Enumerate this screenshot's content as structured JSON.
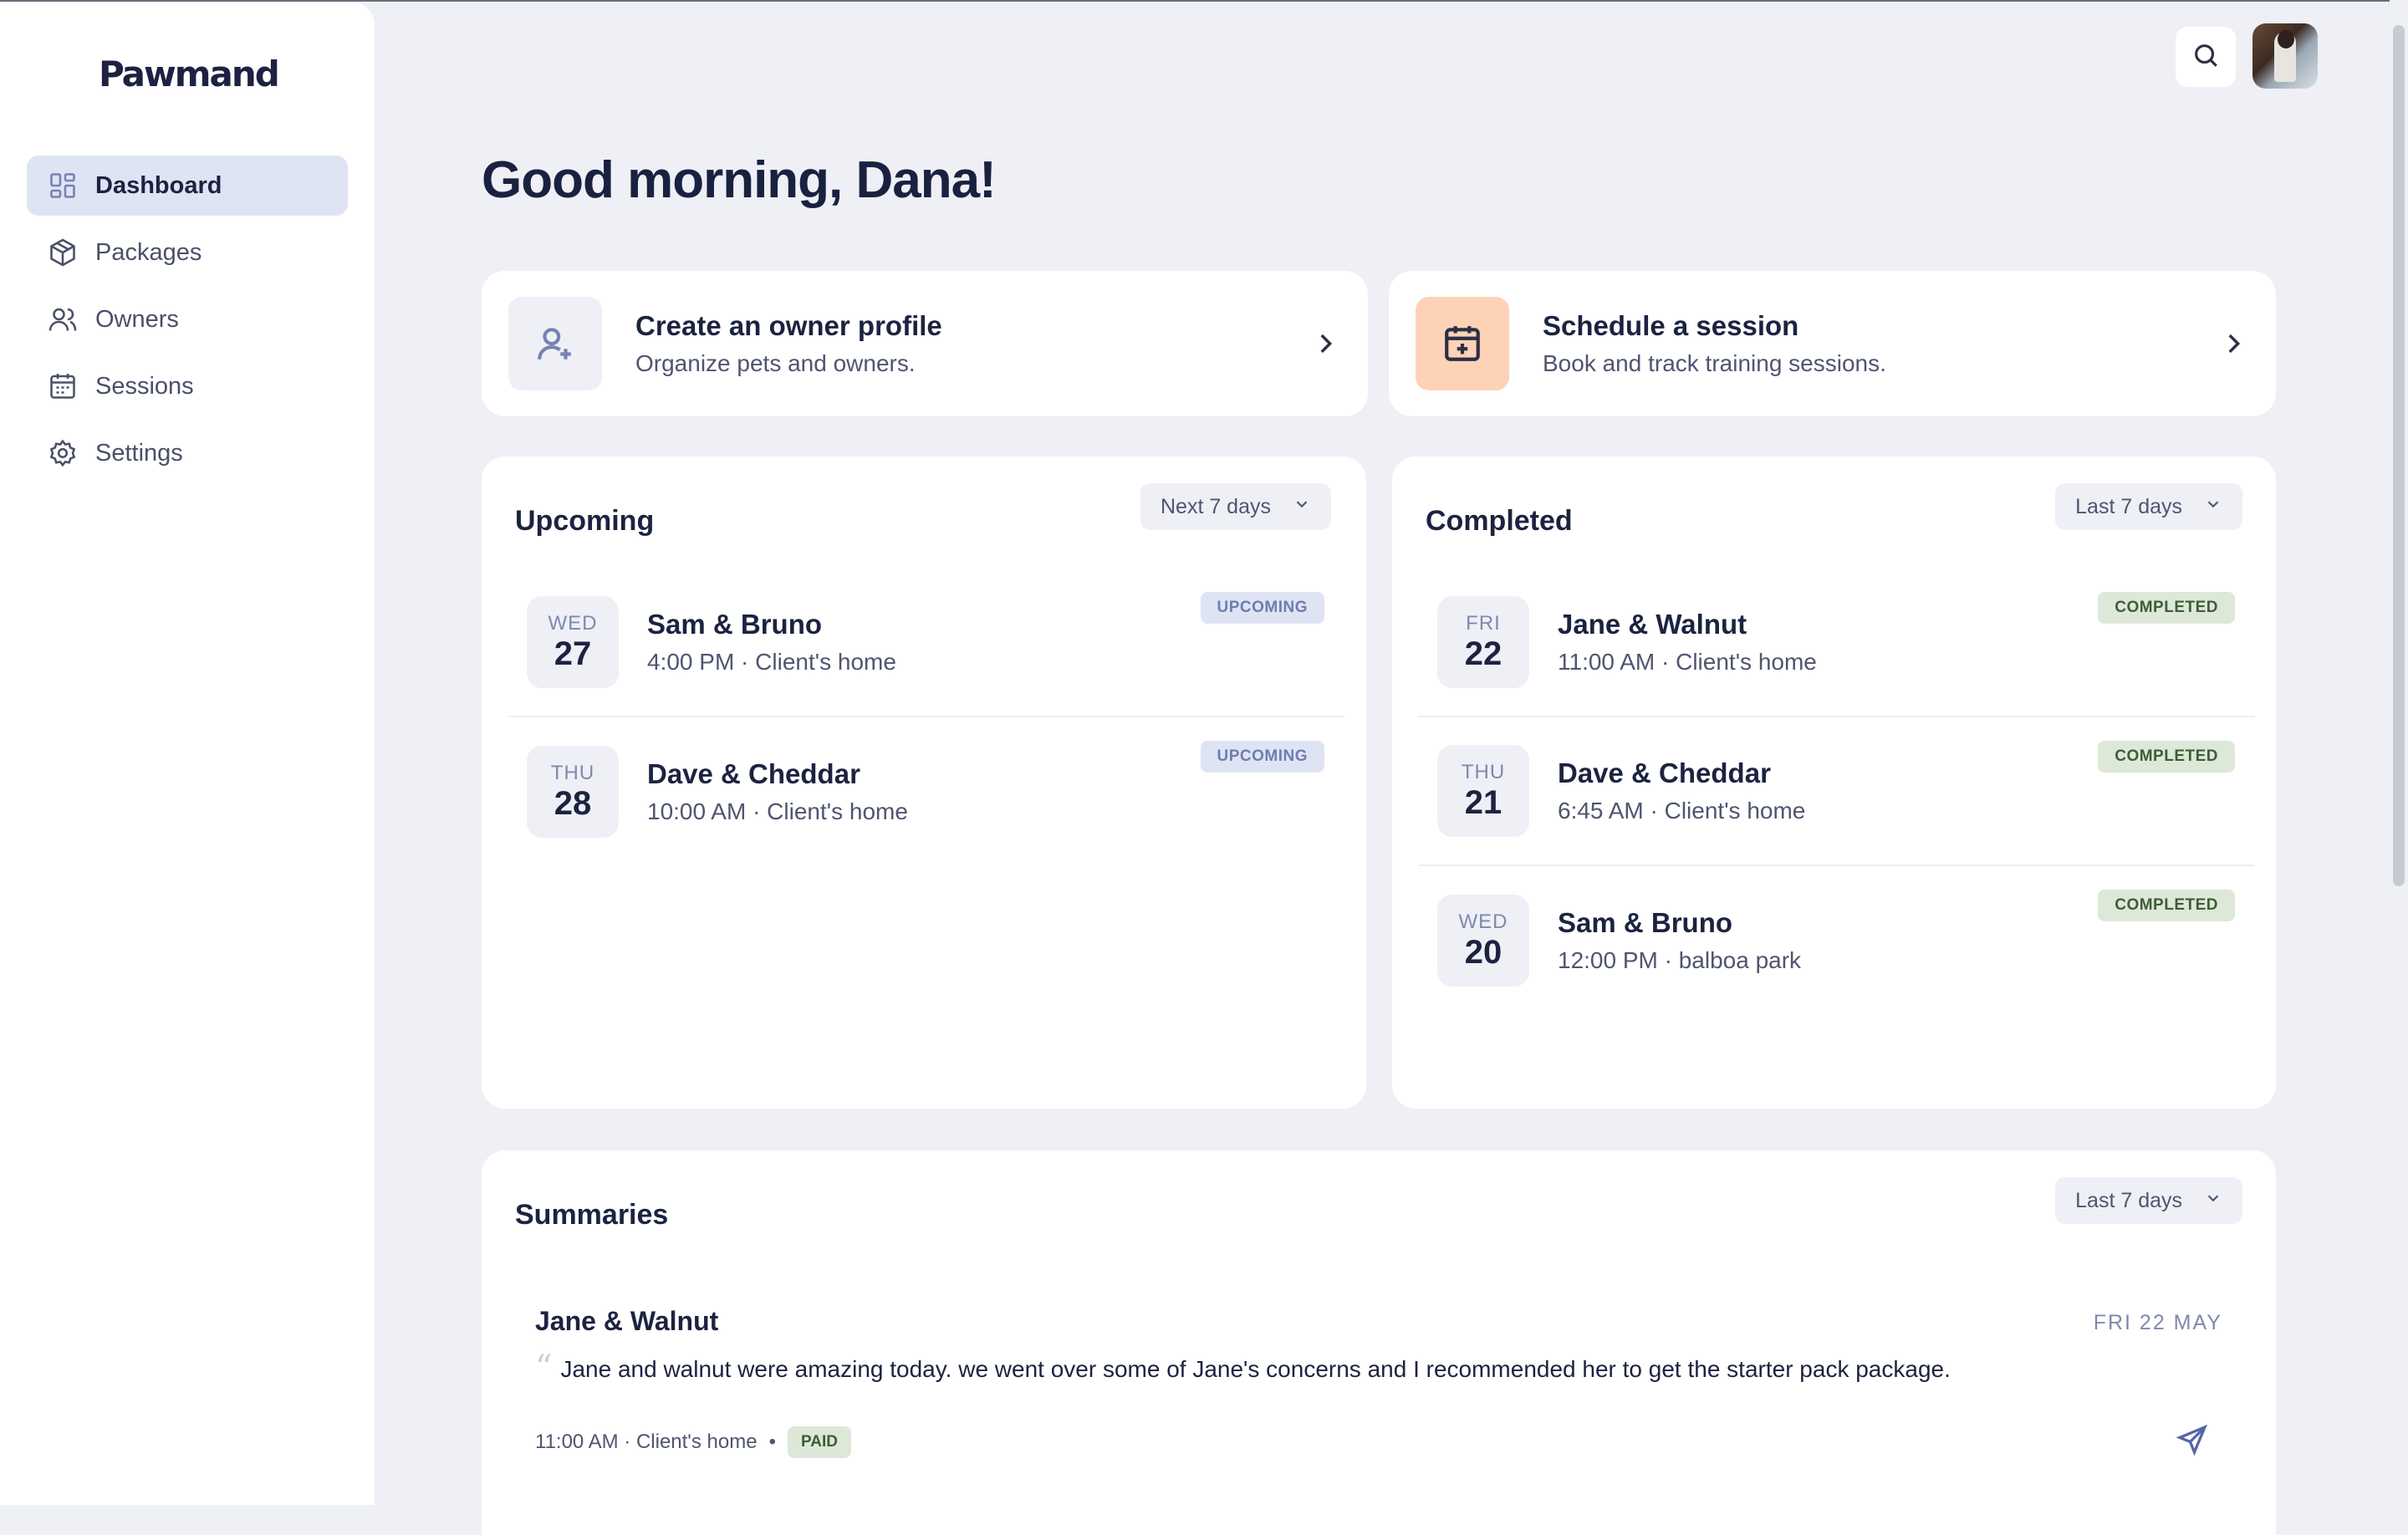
{
  "app": {
    "logo_text": "Pawmand"
  },
  "sidebar": {
    "items": [
      {
        "label": "Dashboard",
        "icon": "grid-icon",
        "active": true
      },
      {
        "label": "Packages",
        "icon": "box-icon",
        "active": false
      },
      {
        "label": "Owners",
        "icon": "users-icon",
        "active": false
      },
      {
        "label": "Sessions",
        "icon": "calendar-icon",
        "active": false
      },
      {
        "label": "Settings",
        "icon": "gear-icon",
        "active": false
      }
    ]
  },
  "header": {
    "greeting": "Good morning, Dana!"
  },
  "actions": {
    "owner": {
      "title": "Create an owner profile",
      "subtitle": "Organize pets and owners.",
      "icon": "user-plus-icon"
    },
    "session": {
      "title": "Schedule a session",
      "subtitle": "Book and track training sessions.",
      "icon": "calendar-plus-icon"
    }
  },
  "upcoming": {
    "title": "Upcoming",
    "filter": "Next 7 days",
    "sessions": [
      {
        "dow": "WED",
        "day": "27",
        "name": "Sam & Bruno",
        "meta": "4:00 PM · Client's home",
        "status": "UPCOMING"
      },
      {
        "dow": "THU",
        "day": "28",
        "name": "Dave & Cheddar",
        "meta": "10:00 AM · Client's home",
        "status": "UPCOMING"
      }
    ]
  },
  "completed": {
    "title": "Completed",
    "filter": "Last 7 days",
    "sessions": [
      {
        "dow": "FRI",
        "day": "22",
        "name": "Jane & Walnut",
        "meta": "11:00 AM · Client's home",
        "status": "COMPLETED"
      },
      {
        "dow": "THU",
        "day": "21",
        "name": "Dave & Cheddar",
        "meta": "6:45 AM · Client's home",
        "status": "COMPLETED"
      },
      {
        "dow": "WED",
        "day": "20",
        "name": "Sam & Bruno",
        "meta": "12:00 PM · balboa park",
        "status": "COMPLETED"
      }
    ]
  },
  "summaries": {
    "title": "Summaries",
    "filter": "Last 7 days",
    "items": [
      {
        "name": "Jane & Walnut",
        "date": "FRI 22 MAY",
        "quote_mark": "“",
        "text": "Jane and walnut were amazing today. we went over some of Jane's concerns and I recommended her to get the starter pack package.",
        "meta": "11:00 AM · Client's home",
        "separator": "•",
        "payment_status": "PAID"
      }
    ]
  },
  "colors": {
    "background": "#eef0f6",
    "accent_blue": "#dfe4f4",
    "accent_orange": "#fdd2b6",
    "completed_green": "#dde8d8"
  }
}
